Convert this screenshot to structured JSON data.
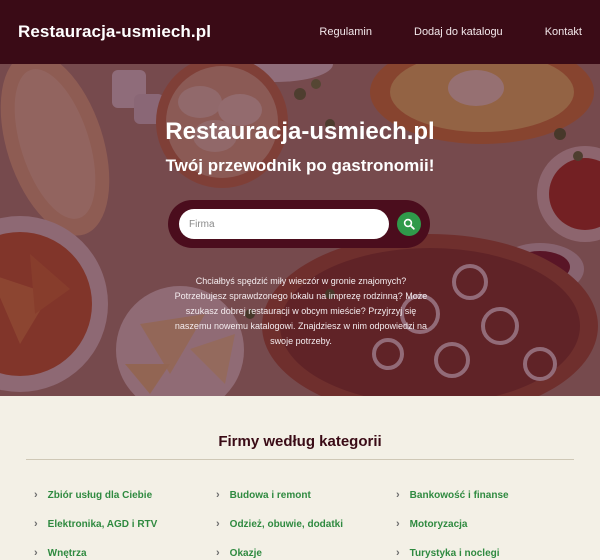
{
  "header": {
    "brand": "Restauracja-usmiech.pl",
    "nav": [
      "Regulamin",
      "Dodaj do katalogu",
      "Kontakt"
    ]
  },
  "hero": {
    "title": "Restauracja-usmiech.pl",
    "subtitle": "Twój przewodnik po gastronomii!",
    "search_placeholder": "Firma",
    "search_icon": "search-icon",
    "description": "Chciałbyś spędzić miły wieczór w gronie znajomych? Potrzebujesz sprawdzonego lokalu na imprezę rodzinną? Może szukasz dobrej restauracji w obcym mieście? Przyjrzyj się naszemu nowemu katalogowi. Znajdziesz w nim odpowiedzi na swoje potrzeby."
  },
  "categories": {
    "title": "Firmy według kategorii",
    "items": [
      "Zbiór usług dla Ciebie",
      "Budowa i remont",
      "Bankowość i finanse",
      "Elektronika, AGD i RTV",
      "Odzież, obuwie, dodatki",
      "Motoryzacja",
      "Wnętrza",
      "Okazje",
      "Turystyka i noclegi"
    ]
  },
  "colors": {
    "header_bg": "#3a0b16",
    "overlay": "#4e1228",
    "accent_green": "#2f9a4a",
    "category_link": "#2f8a40",
    "page_bg": "#f3f0e6"
  }
}
